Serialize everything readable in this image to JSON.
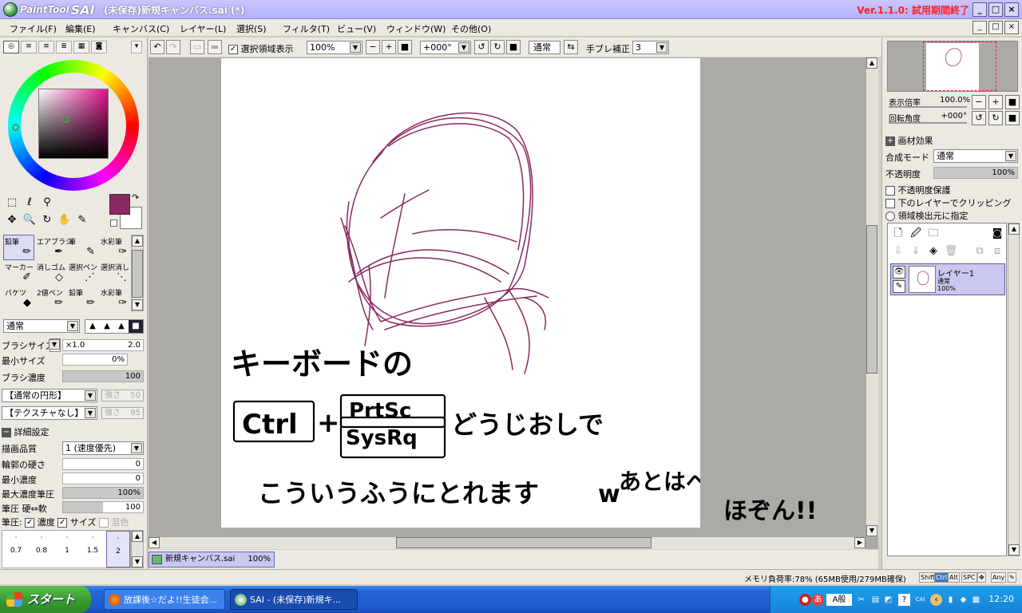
{
  "titlebar": {
    "logo_text": "PaintTool",
    "logo_sai": "SAI",
    "title": "(未保存)新規キャンバス.sai (*)",
    "version": "Ver.1.1.0: 試用期間終了",
    "buttons": [
      "_",
      "□",
      "×"
    ]
  },
  "menu": {
    "items": [
      "ファイル(F)",
      "編集(E)",
      "キャンバス(C)",
      "レイヤー(L)",
      "選択(S)",
      "フィルタ(T)",
      "ビュー(V)",
      "ウィンドウ(W)",
      "その他(O)"
    ],
    "mdi_buttons": [
      "_",
      "□",
      "×"
    ]
  },
  "toolbar": {
    "show_selection_label": "選択領域表示",
    "zoom": "100%",
    "rotation": "+000°",
    "blend_mode": "通常",
    "stabilizer_label": "手ブレ補正",
    "stabilizer_value": "3"
  },
  "color_panel": {
    "foreground_color": "#8a2a62",
    "background_color": "#ffffff"
  },
  "tools": [
    {
      "name": "鉛筆",
      "icon": "pencil-icon"
    },
    {
      "name": "エアブラシ",
      "icon": "airbrush-icon"
    },
    {
      "name": "筆",
      "icon": "brush-icon"
    },
    {
      "name": "水彩筆",
      "icon": "watercolor-icon"
    },
    {
      "name": "マーカー",
      "icon": "marker-icon"
    },
    {
      "name": "消しゴム",
      "icon": "eraser-icon"
    },
    {
      "name": "選択ペン",
      "icon": "select-pen-icon"
    },
    {
      "name": "選択消し",
      "icon": "select-erase-icon"
    },
    {
      "name": "バケツ",
      "icon": "bucket-icon"
    },
    {
      "name": "2値ペン",
      "icon": "binary-pen-icon"
    },
    {
      "name": "鉛筆",
      "icon": "pencil-icon"
    },
    {
      "name": "水彩筆",
      "icon": "watercolor-icon"
    }
  ],
  "brush": {
    "mode": "通常",
    "size_label": "ブラシサイズ",
    "size_mult": "×1.0",
    "size_value": "2.0",
    "min_size_label": "最小サイズ",
    "min_size_value": "0%",
    "density_label": "ブラシ濃度",
    "density_value": "100",
    "shape": "【通常の円形】",
    "shape_strength_label": "強さ",
    "shape_strength": "50",
    "texture": "【テクスチャなし】",
    "texture_strength_label": "強さ",
    "texture_strength": "95",
    "advanced_label": "詳細設定",
    "quality_label": "描画品質",
    "quality_value": "1 (速度優先)",
    "edge_label": "輪郭の硬さ",
    "edge_value": "0",
    "min_density_label": "最小濃度",
    "min_density_value": "0",
    "max_pressure_label": "最大濃度筆圧",
    "max_pressure_value": "100%",
    "pressure_hardness_label": "筆圧 硬⇔軟",
    "pressure_hardness_value": "100",
    "pressure_label": "筆圧:",
    "pressure_density": "濃度",
    "pressure_size": "サイズ",
    "pressure_blend": "混色",
    "sizes": [
      "0.7",
      "0.8",
      "1",
      "1.5",
      "2"
    ]
  },
  "canvas": {
    "text_line1": "キーボードの",
    "text_ctrl": "Ctrl",
    "text_plus": "+",
    "text_prtsc": "PrtSc",
    "text_sysrq": "SysRq",
    "text_line2_rest": "どうじおしで",
    "text_line3": "こういうふうにとれます",
    "text_w": "w",
    "text_line3b": "あとはペイントで",
    "text_line4": "ほぞん!!"
  },
  "doc_tab": {
    "name": "新規キャンバス.sai",
    "zoom": "100%"
  },
  "right_panel": {
    "zoom_label": "表示倍率",
    "zoom_value": "100.0%",
    "angle_label": "回転角度",
    "angle_value": "+000°",
    "paper_effect": "画材効果",
    "blend_label": "合成モード",
    "blend_value": "通常",
    "opacity_label": "不透明度",
    "opacity_value": "100%",
    "preserve_opacity": "不透明度保護",
    "clip_below": "下のレイヤーでクリッピング",
    "selection_source": "領域検出元に指定",
    "layer_name": "レイヤー1",
    "layer_mode": "通常",
    "layer_opacity": "100%"
  },
  "status": {
    "memory": "メモリ負荷率:78% (65MB使用/279MB確保)",
    "keys": [
      "Shift",
      "Ctrl",
      "Alt",
      "SPC",
      "✥",
      "Any"
    ]
  },
  "taskbar": {
    "start": "スタート",
    "tasks": [
      "放課後☆だよ!!生徒会...",
      "SAI - (未保存)新規キ..."
    ],
    "ime": "A般",
    "clock": "12:20"
  }
}
